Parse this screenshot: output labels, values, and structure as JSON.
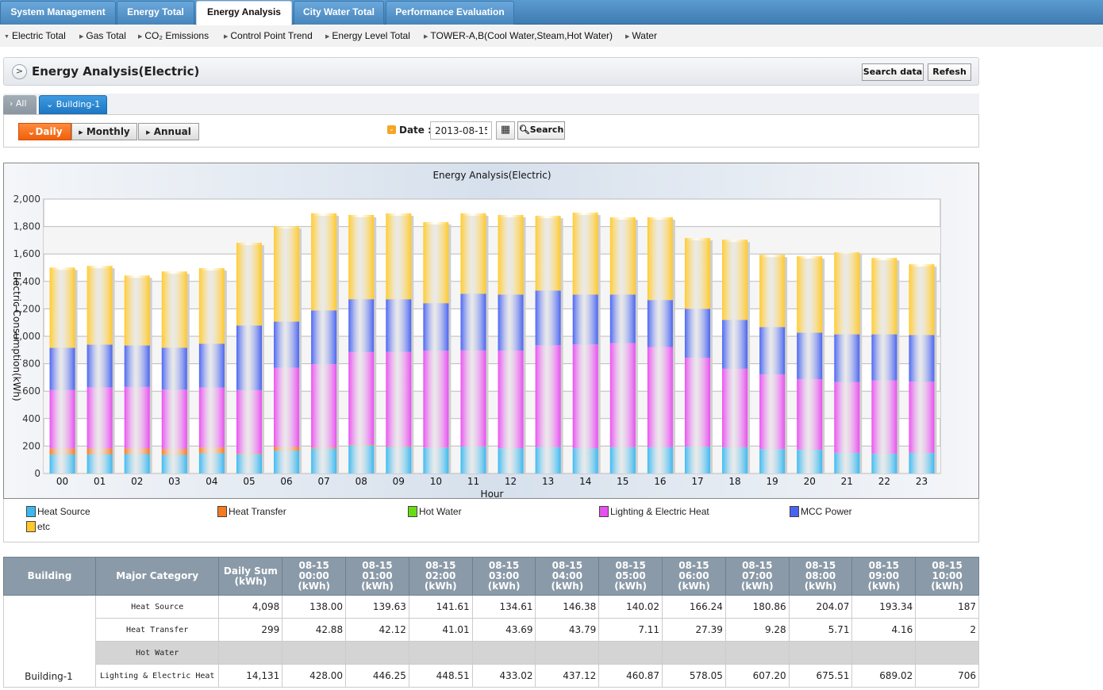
{
  "topnav": {
    "tabs": [
      {
        "label": "System Management",
        "active": false
      },
      {
        "label": "Energy Total",
        "active": false
      },
      {
        "label": "Energy Analysis",
        "active": true
      },
      {
        "label": "City Water Total",
        "active": false
      },
      {
        "label": "Performance Evaluation",
        "active": false
      }
    ]
  },
  "subnav": {
    "items": [
      {
        "label": "Electric Total",
        "active": true
      },
      {
        "label": "Gas Total",
        "active": false
      },
      {
        "label": "CO₂ Emissions",
        "active": false
      },
      {
        "label": "Control Point Trend",
        "active": false
      },
      {
        "label": "Energy Level Total",
        "active": false
      },
      {
        "label": "TOWER-A,B(Cool Water,Steam,Hot Water)",
        "active": false
      },
      {
        "label": "Water",
        "active": false
      }
    ]
  },
  "panel": {
    "title": "Energy Analysis(Electric)",
    "search_data_label": "Search data",
    "refresh_label": "Refesh"
  },
  "building_tabs": [
    {
      "label": "All",
      "active": false
    },
    {
      "label": "Building-1",
      "active": true
    }
  ],
  "filter": {
    "periods": [
      {
        "label": "Daily",
        "active": true
      },
      {
        "label": "Monthly",
        "active": false
      },
      {
        "label": "Annual",
        "active": false
      }
    ],
    "date_label": "Date :",
    "date_value": "2013-08-15",
    "search_label": "Search"
  },
  "chart_data": {
    "type": "bar",
    "stacked": true,
    "title": "Energy Analysis(Electric)",
    "xlabel": "Hour",
    "ylabel": "Electric Consumption(kWh)",
    "ylim": [
      0,
      2000
    ],
    "yticks": [
      "0",
      "200",
      "400",
      "600",
      "800",
      "1,000",
      "1,200",
      "1,400",
      "1,600",
      "1,800",
      "2,000"
    ],
    "grid": true,
    "legend_position": "bottom",
    "categories": [
      "00",
      "01",
      "02",
      "03",
      "04",
      "05",
      "06",
      "07",
      "08",
      "09",
      "10",
      "11",
      "12",
      "13",
      "14",
      "15",
      "16",
      "17",
      "18",
      "19",
      "20",
      "21",
      "22",
      "23"
    ],
    "series": [
      {
        "name": "Heat Source",
        "color": "#3cb8f0",
        "values": [
          138.0,
          139.63,
          141.61,
          134.61,
          146.38,
          140.02,
          166.24,
          180.86,
          204.07,
          193.34,
          187,
          196,
          183,
          192,
          183,
          192,
          191,
          195,
          191,
          177,
          173,
          150,
          144,
          150
        ]
      },
      {
        "name": "Heat Transfer",
        "color": "#f57a22",
        "values": [
          42.88,
          42.12,
          41.01,
          43.69,
          43.79,
          7.11,
          27.39,
          9.28,
          5.71,
          4.16,
          2,
          1,
          1,
          1,
          1,
          1,
          1,
          1,
          1,
          1,
          1,
          1,
          1,
          1
        ]
      },
      {
        "name": "Hot Water",
        "color": "#66dd11",
        "values": [
          0,
          0,
          0,
          0,
          0,
          0,
          0,
          0,
          0,
          0,
          0,
          0,
          0,
          0,
          0,
          0,
          0,
          0,
          0,
          0,
          0,
          0,
          0,
          0
        ]
      },
      {
        "name": "Lighting & Electric Heat",
        "color": "#e84ff0",
        "values": [
          428.0,
          446.25,
          448.51,
          433.02,
          437.12,
          460.87,
          578.05,
          607.2,
          675.51,
          689.02,
          706,
          700,
          712,
          742,
          757,
          758,
          730,
          648,
          572,
          545,
          514,
          516,
          534,
          518
        ]
      },
      {
        "name": "MCC Power",
        "color": "#4a64f0",
        "values": [
          307,
          311,
          302,
          305,
          318,
          470,
          335,
          391,
          385,
          383,
          346,
          413,
          408,
          398,
          363,
          353,
          342,
          356,
          355,
          344,
          338,
          347,
          335,
          340
        ]
      },
      {
        "name": "etc",
        "color": "#ffc92a",
        "values": [
          585,
          574,
          510,
          556,
          551,
          603,
          696,
          708,
          614,
          626,
          591,
          586,
          580,
          545,
          597,
          563,
          603,
          516,
          585,
          527,
          557,
          598,
          557,
          516
        ]
      }
    ]
  },
  "table": {
    "headers": {
      "building": "Building",
      "category": "Major Category",
      "daily_sum": [
        "Daily Sum",
        "(kWh)"
      ],
      "hours": [
        [
          "08-15",
          "00:00",
          "(kWh)"
        ],
        [
          "08-15",
          "01:00",
          "(kWh)"
        ],
        [
          "08-15",
          "02:00",
          "(kWh)"
        ],
        [
          "08-15",
          "03:00",
          "(kWh)"
        ],
        [
          "08-15",
          "04:00",
          "(kWh)"
        ],
        [
          "08-15",
          "05:00",
          "(kWh)"
        ],
        [
          "08-15",
          "06:00",
          "(kWh)"
        ],
        [
          "08-15",
          "07:00",
          "(kWh)"
        ],
        [
          "08-15",
          "08:00",
          "(kWh)"
        ],
        [
          "08-15",
          "09:00",
          "(kWh)"
        ],
        [
          "08-15",
          "10:00",
          "(kWh)"
        ]
      ]
    },
    "building": "Building-1",
    "rows": [
      {
        "category": "Heat Source",
        "sum": "4,098",
        "values": [
          "138.00",
          "139.63",
          "141.61",
          "134.61",
          "146.38",
          "140.02",
          "166.24",
          "180.86",
          "204.07",
          "193.34",
          "187"
        ],
        "grey": false
      },
      {
        "category": "Heat Transfer",
        "sum": "299",
        "values": [
          "42.88",
          "42.12",
          "41.01",
          "43.69",
          "43.79",
          "7.11",
          "27.39",
          "9.28",
          "5.71",
          "4.16",
          "2"
        ],
        "grey": false
      },
      {
        "category": "Hot Water",
        "sum": "",
        "values": [
          "",
          "",
          "",
          "",
          "",
          "",
          "",
          "",
          "",
          "",
          ""
        ],
        "grey": true
      },
      {
        "category": "Lighting & Electric Heat",
        "sum": "14,131",
        "values": [
          "428.00",
          "446.25",
          "448.51",
          "433.02",
          "437.12",
          "460.87",
          "578.05",
          "607.20",
          "675.51",
          "689.02",
          "706"
        ],
        "grey": false
      }
    ]
  }
}
